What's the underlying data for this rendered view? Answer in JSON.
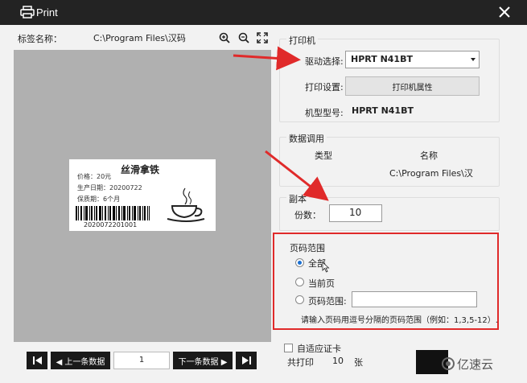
{
  "window": {
    "title": "Print"
  },
  "left": {
    "label_name_text": "标签名称：",
    "label_path": "C:\\Program Files\\汉码",
    "preview": {
      "title": "丝滑拿铁",
      "lines": [
        "价格：20元",
        "生产日期：20200722",
        "保质期：6个月"
      ],
      "barcode_number": "2020072201001"
    },
    "nav": {
      "prev_label": "◀ 上一条数据",
      "page_value": "1",
      "next_label": "下一条数据 ▶"
    }
  },
  "printer_group": {
    "title": "打印机",
    "driver_label": "驱动选择:",
    "driver_value": "HPRT N41BT",
    "settings_label": "打印设置:",
    "settings_button": "打印机属性",
    "model_label": "机型型号:",
    "model_value": "HPRT N41BT"
  },
  "data_group": {
    "title": "数据调用",
    "col_type": "类型",
    "col_name": "名称",
    "name_value": "C:\\Program Files\\汉"
  },
  "copies_group": {
    "title": "副本",
    "copies_label": "份数：",
    "copies_value": "10"
  },
  "page_range_group": {
    "title": "页码范围",
    "options": [
      "全部",
      "当前页",
      "页码范围:"
    ],
    "hint": "请输入页码用逗号分隔的页码范围（例如：1,3,5-12）."
  },
  "bottom": {
    "auto_card_label": "自适应证卡",
    "total_prefix": "共打印",
    "total_value": "10",
    "total_suffix": "张",
    "watermark": "亿速云"
  },
  "colors": {
    "accent_red": "#e02a2a",
    "titlebar": "#232323"
  }
}
